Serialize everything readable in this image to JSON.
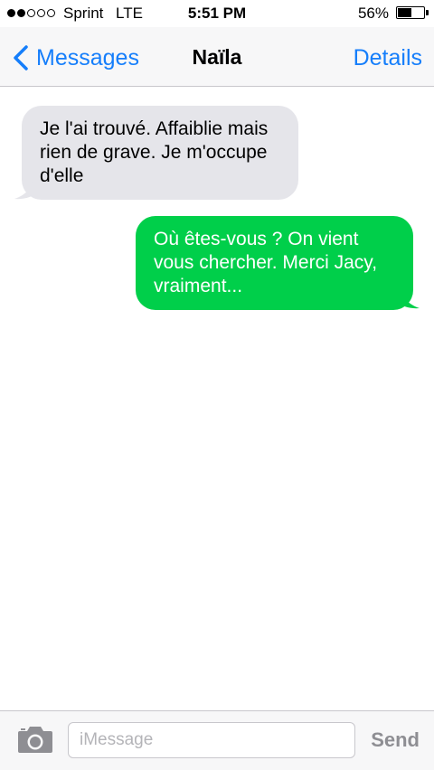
{
  "status_bar": {
    "signal_bars": 2,
    "signal_total": 5,
    "carrier": "Sprint",
    "network": "LTE",
    "time": "5:51 PM",
    "battery_percent": "56%",
    "battery_level": 0.56
  },
  "nav": {
    "back_label": "Messages",
    "title": "Naïla",
    "details_label": "Details",
    "accent_color": "#157efb"
  },
  "messages": [
    {
      "direction": "received",
      "text": "Je l'ai trouvé. Affaiblie mais rien de grave. Je m'occupe d'elle",
      "bubble_color": "#e5e5ea"
    },
    {
      "direction": "sent",
      "text": "Où êtes-vous ? On vient vous chercher. Merci Jacy, vraiment...",
      "bubble_color": "#00cf4a"
    }
  ],
  "input_bar": {
    "camera_icon": "camera-icon",
    "placeholder": "iMessage",
    "value": "",
    "send_label": "Send"
  }
}
